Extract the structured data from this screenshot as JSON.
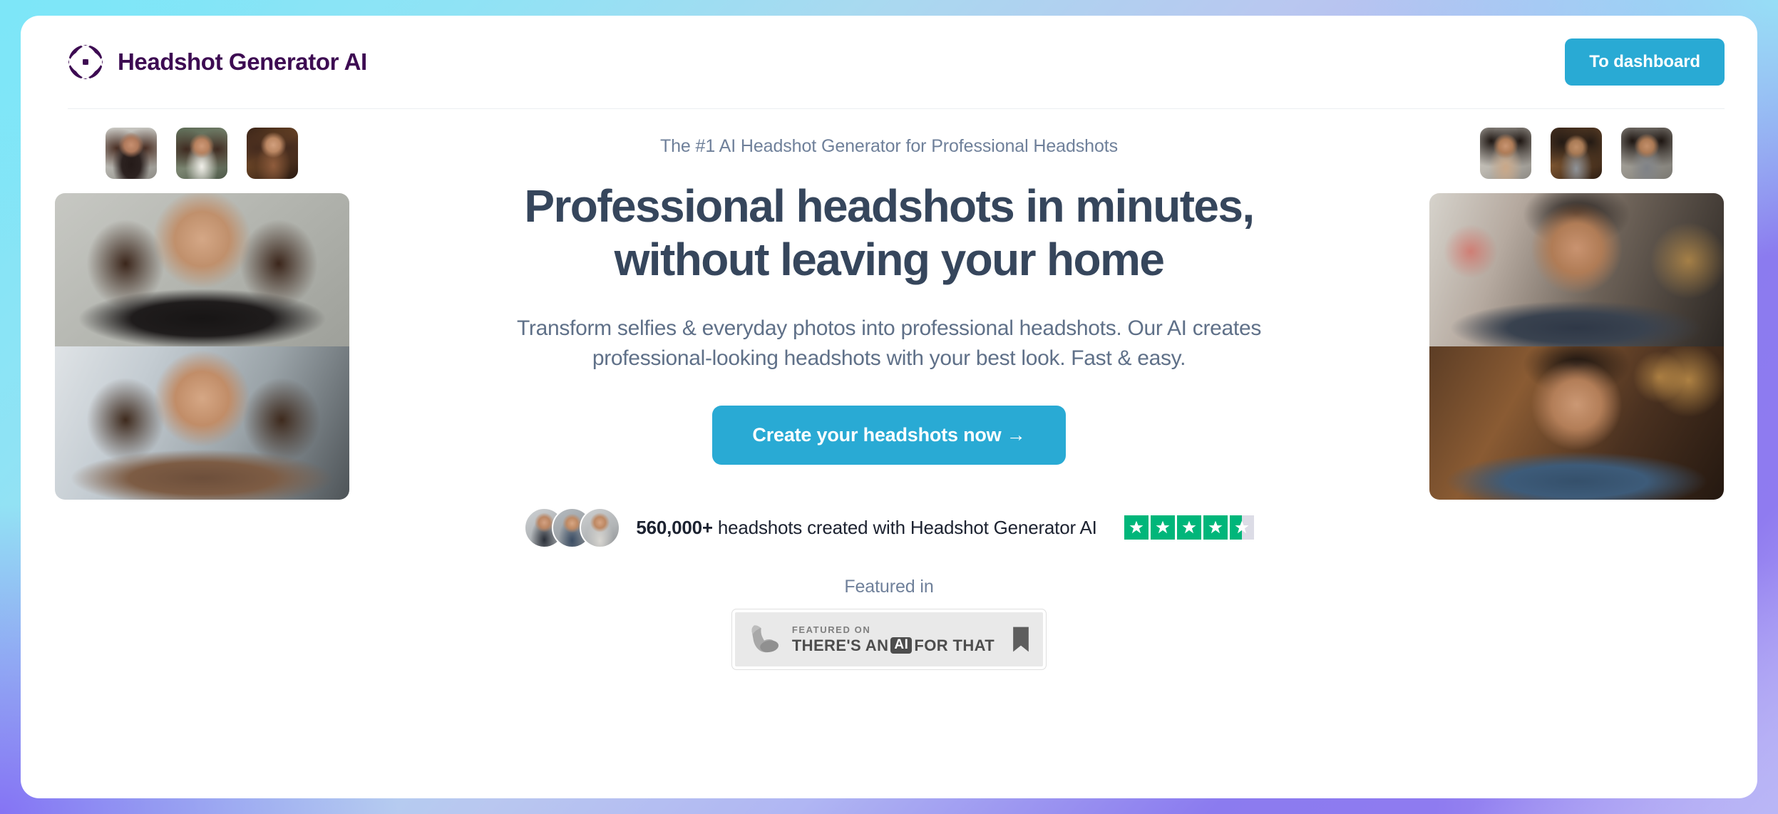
{
  "header": {
    "brand_name": "Headshot Generator AI",
    "logo_icon": "aperture-flower-logo",
    "dashboard_button": "To dashboard"
  },
  "hero": {
    "eyebrow": "The #1 AI Headshot Generator for Professional Headshots",
    "headline_line1": "Professional headshots in minutes,",
    "headline_line2": "without leaving your home",
    "subhead_line1": "Transform selfies & everyday photos into professional headshots. Our AI creates",
    "subhead_line2": "professional-looking headshots with your best look. Fast & easy.",
    "cta_label": "Create your headshots now →"
  },
  "social_proof": {
    "count": "560,000+",
    "text": " headshots created with Headshot Generator AI",
    "rating_stars_full": 4,
    "rating_stars_half": 1,
    "star_color": "#00b67a",
    "star_empty_color": "#dcdce6"
  },
  "featured": {
    "label": "Featured in",
    "badge_top": "FEATURED ON",
    "badge_main_pre": "THERE'S AN",
    "badge_main_chip": "AI",
    "badge_main_post": "FOR THAT",
    "badge_arm_icon": "flexed-arm-icon",
    "badge_bookmark_icon": "bookmark-icon"
  },
  "gallery": {
    "left_thumbs": [
      "woman-thumb-1",
      "woman-thumb-2",
      "woman-thumb-3"
    ],
    "left_large": [
      "woman-large-1",
      "woman-large-2"
    ],
    "right_thumbs": [
      "man-thumb-1",
      "man-thumb-2",
      "man-thumb-3"
    ],
    "right_large": [
      "man-large-1",
      "man-large-2"
    ]
  },
  "colors": {
    "accent": "#29aad4",
    "brand_purple": "#3d0b52",
    "heading": "#36465c",
    "muted": "#6f809a"
  }
}
